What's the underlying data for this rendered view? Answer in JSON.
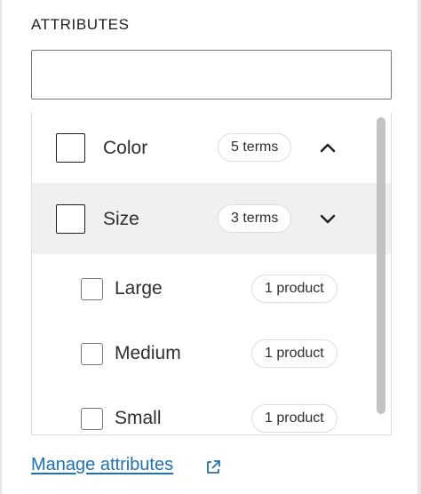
{
  "section": {
    "title": "ATTRIBUTES"
  },
  "search": {
    "value": "",
    "placeholder": ""
  },
  "attributes": [
    {
      "label": "Color",
      "terms_badge": "5 terms",
      "expanded": false,
      "checked": false,
      "chevron_icon": "chevron-up-icon"
    },
    {
      "label": "Size",
      "terms_badge": "3 terms",
      "expanded": true,
      "checked": false,
      "chevron_icon": "chevron-down-icon",
      "terms": [
        {
          "label": "Large",
          "count_badge": "1 product",
          "checked": false
        },
        {
          "label": "Medium",
          "count_badge": "1 product",
          "checked": false
        },
        {
          "label": "Small",
          "count_badge": "1 product",
          "checked": false
        }
      ]
    }
  ],
  "footer": {
    "manage_link_label": "Manage attributes",
    "external_icon": "external-link-icon"
  },
  "colors": {
    "link": "#2271b1",
    "selected_row_bg": "#f0f0f0",
    "scrollbar_thumb": "#c2c2c2"
  }
}
